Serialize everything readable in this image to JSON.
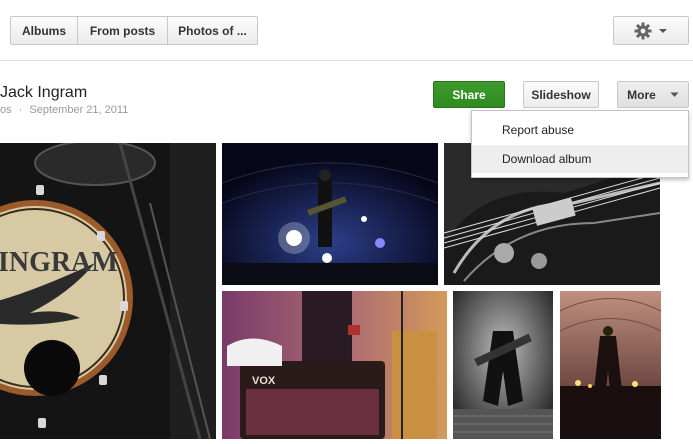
{
  "tabs": {
    "albums": "Albums",
    "from_posts": "From posts",
    "photos_of": "Photos of ..."
  },
  "album": {
    "title": "Jack Ingram",
    "meta_prefix": "os",
    "meta_sep": "·",
    "date": "September 21, 2011"
  },
  "actions": {
    "share": "Share",
    "slideshow": "Slideshow",
    "more": "More"
  },
  "menu": {
    "items": [
      "Report abuse",
      "Download album"
    ],
    "highlighted_index": 1
  },
  "photos": {
    "drum_text": "INGRAM",
    "amp_text": "VOX"
  },
  "colors": {
    "share_green": "#339a22",
    "menu_highlight": "#eeeeee"
  },
  "icons": {
    "settings": "gear-icon",
    "settings_caret": "caret-down-icon",
    "more_caret": "caret-down-icon"
  }
}
